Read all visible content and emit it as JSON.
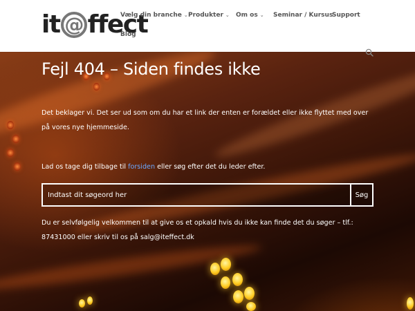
{
  "header": {
    "logo": {
      "part1": "it",
      "at": "@",
      "part2": "ffect"
    },
    "nav": [
      {
        "label": "Vælg din branche",
        "has_dropdown": true
      },
      {
        "label": "Produkter",
        "has_dropdown": true
      },
      {
        "label": "Om os",
        "has_dropdown": true
      },
      {
        "label": "Seminar / Kursus",
        "has_dropdown": false
      },
      {
        "label": "Support",
        "has_dropdown": false
      }
    ],
    "nav_second_row": {
      "label": "Blog"
    },
    "search_icon": "search-icon",
    "chevron_icon": "chevron-down-icon"
  },
  "main": {
    "title": "Fejl 404 – Siden findes ikke",
    "paragraph1": "Det beklager vi. Det ser ud som om du har et link der enten er forældet eller ikke flyttet med over på vores nye hjemmeside.",
    "paragraph2": {
      "before": "Lad os tage dig tilbage til ",
      "link": "forsiden",
      "after": " eller søg efter det du leder efter."
    },
    "search": {
      "placeholder": "Indtast dit søgeord her",
      "button": "Søg"
    },
    "paragraph3": "Du er selvfølgelig velkommen til at give os et opkald hvis du ikke kan finde det du søger – tlf.: 87431000 eller skriv til os på salg@iteffect.dk"
  },
  "colors": {
    "link": "#6aa8ff",
    "header_bg": "#ffffff",
    "text_on_bg": "#ffffff"
  }
}
